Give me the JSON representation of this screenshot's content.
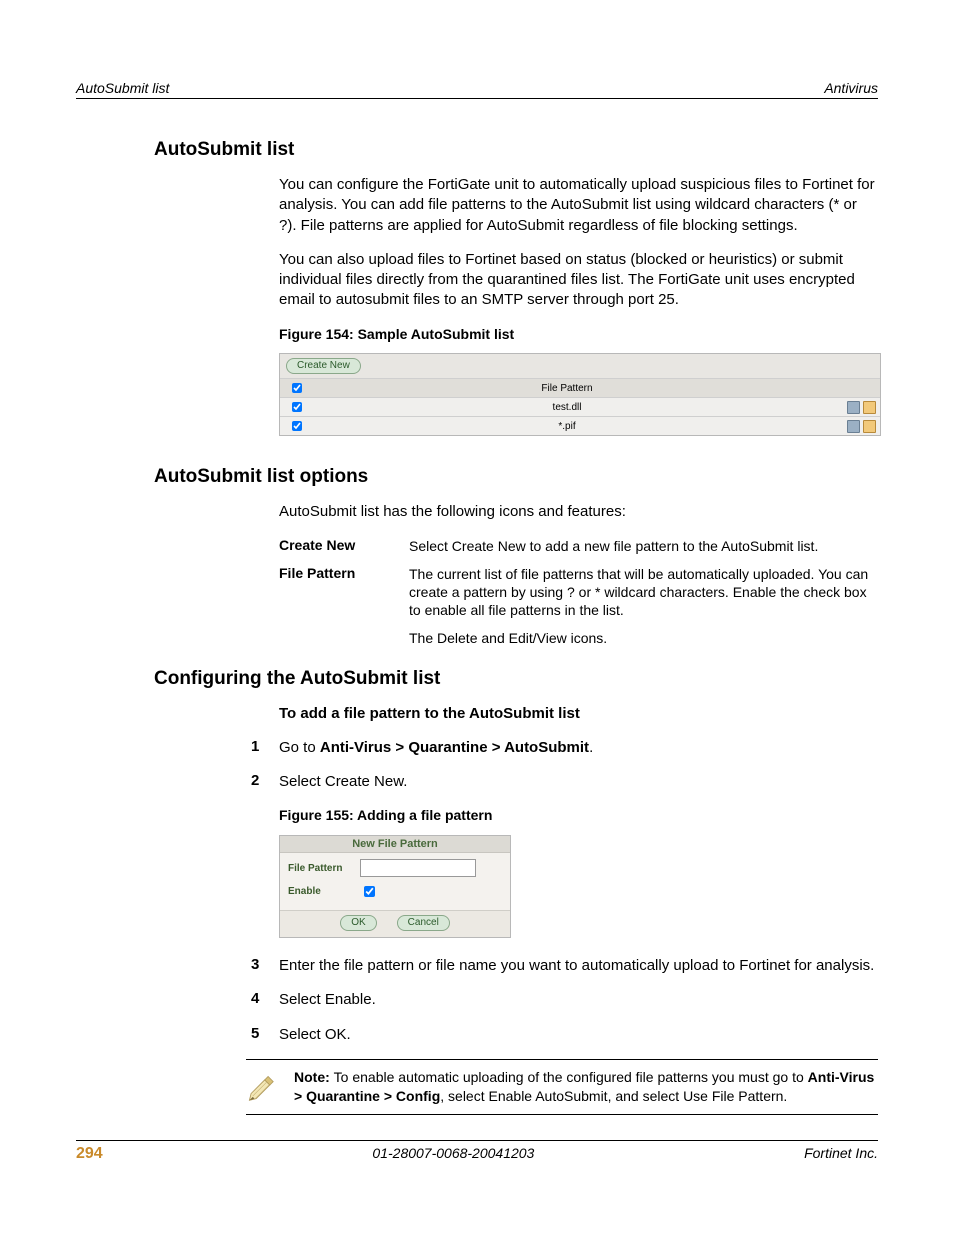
{
  "header": {
    "left": "AutoSubmit list",
    "right": "Antivirus"
  },
  "h1": "AutoSubmit list",
  "p1": "You can configure the FortiGate unit to automatically upload suspicious files to Fortinet for analysis. You can add file patterns to the AutoSubmit list using wildcard characters (* or ?). File patterns are applied for AutoSubmit regardless of file blocking settings.",
  "p2": "You can also upload files to Fortinet based on status (blocked or heuristics) or submit individual files directly from the quarantined files list. The FortiGate unit uses encrypted email to autosubmit files to an SMTP server through port 25.",
  "fig154_caption": "Figure 154: Sample AutoSubmit list",
  "fig154": {
    "create_new": "Create New",
    "col": "File Pattern",
    "rows": [
      "test.dll",
      "*.pif"
    ]
  },
  "h2": "AutoSubmit list options",
  "p3": "AutoSubmit list has the following icons and features:",
  "opts": [
    {
      "k": "Create New",
      "v": "Select Create New to add a new file pattern to the AutoSubmit list."
    },
    {
      "k": "File Pattern",
      "v": "The current list of file patterns that will be automatically uploaded. You can create a pattern by using ? or * wildcard characters. Enable the check box to enable all file patterns in the list."
    },
    {
      "k": "",
      "v": "The Delete and Edit/View icons."
    }
  ],
  "h3": "Configuring the AutoSubmit list",
  "sub1": "To add a file pattern to the AutoSubmit list",
  "step1_pre": "Go to ",
  "step1_bold": "Anti-Virus > Quarantine > AutoSubmit",
  "step1_post": ".",
  "step2": "Select Create New.",
  "fig155_caption": "Figure 155: Adding a file pattern",
  "fig155": {
    "title": "New File Pattern",
    "lbl1": "File Pattern",
    "lbl2": "Enable",
    "ok": "OK",
    "cancel": "Cancel"
  },
  "step3": "Enter the file pattern or file name you want to automatically upload to Fortinet for analysis.",
  "step4": "Select Enable.",
  "step5": "Select OK.",
  "note_pre": "Note: ",
  "note_mid1": "To enable automatic uploading of the configured file patterns you must go to ",
  "note_bold": "Anti-Virus > Quarantine > Config",
  "note_post": ", select Enable AutoSubmit, and select Use File Pattern.",
  "footer": {
    "page": "294",
    "mid": "01-28007-0068-20041203",
    "right": "Fortinet Inc."
  }
}
